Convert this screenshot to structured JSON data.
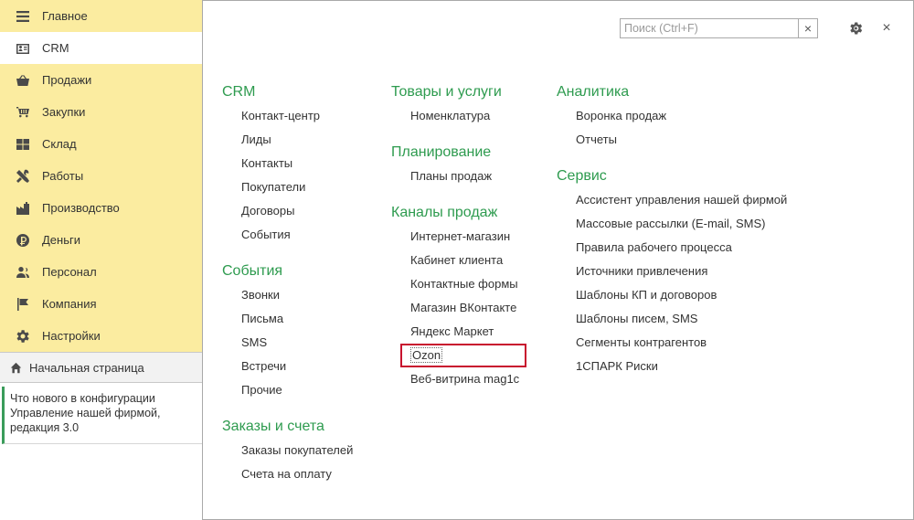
{
  "sidebar": {
    "sections": [
      {
        "label": "Главное",
        "icon": "menu-icon"
      },
      {
        "label": "CRM",
        "icon": "crm-card-icon"
      },
      {
        "label": "Продажи",
        "icon": "basket-icon"
      },
      {
        "label": "Закупки",
        "icon": "cart-icon"
      },
      {
        "label": "Склад",
        "icon": "warehouse-grid-icon"
      },
      {
        "label": "Работы",
        "icon": "tools-icon"
      },
      {
        "label": "Производство",
        "icon": "factory-icon"
      },
      {
        "label": "Деньги",
        "icon": "coin-icon"
      },
      {
        "label": "Персонал",
        "icon": "people-icon"
      },
      {
        "label": "Компания",
        "icon": "flag-icon"
      },
      {
        "label": "Настройки",
        "icon": "gear-icon"
      }
    ],
    "active_section": "CRM",
    "home": "Начальная страница",
    "news": [
      "Что нового в конфигурации",
      "Управление нашей фирмой,",
      "редакция 3.0"
    ]
  },
  "search": {
    "placeholder": "Поиск (Ctrl+F)",
    "clear": "×"
  },
  "window": {
    "close": "×"
  },
  "columns": [
    [
      {
        "title": "CRM",
        "items": [
          "Контакт-центр",
          "Лиды",
          "Контакты",
          "Покупатели",
          "Договоры",
          "События"
        ]
      },
      {
        "title": "События",
        "items": [
          "Звонки",
          "Письма",
          "SMS",
          "Встречи",
          "Прочие"
        ]
      },
      {
        "title": "Заказы и счета",
        "items": [
          "Заказы покупателей",
          "Счета на оплату"
        ]
      }
    ],
    [
      {
        "title": "Товары и услуги",
        "items": [
          "Номенклатура"
        ]
      },
      {
        "title": "Планирование",
        "items": [
          "Планы продаж"
        ]
      },
      {
        "title": "Каналы продаж",
        "items": [
          "Интернет-магазин",
          "Кабинет клиента",
          "Контактные формы",
          "Магазин ВКонтакте",
          "Яндекс Маркет",
          "Ozon",
          "Веб-витрина mag1c"
        ]
      }
    ],
    [
      {
        "title": "Аналитика",
        "items": [
          "Воронка продаж",
          "Отчеты"
        ]
      },
      {
        "title": "Сервис",
        "items": [
          "Ассистент управления нашей фирмой",
          "Массовые рассылки (E-mail, SMS)",
          "Правила рабочего процесса",
          "Источники привлечения",
          "Шаблоны КП и договоров",
          "Шаблоны писем, SMS",
          "Сегменты контрагентов",
          "1СПАРК Риски"
        ]
      }
    ]
  ],
  "highlighted_item": "Ozon",
  "colors": {
    "sidebar_bg": "#fbeca0",
    "group_title": "#2e9b4f",
    "highlight": "#c8102e"
  }
}
